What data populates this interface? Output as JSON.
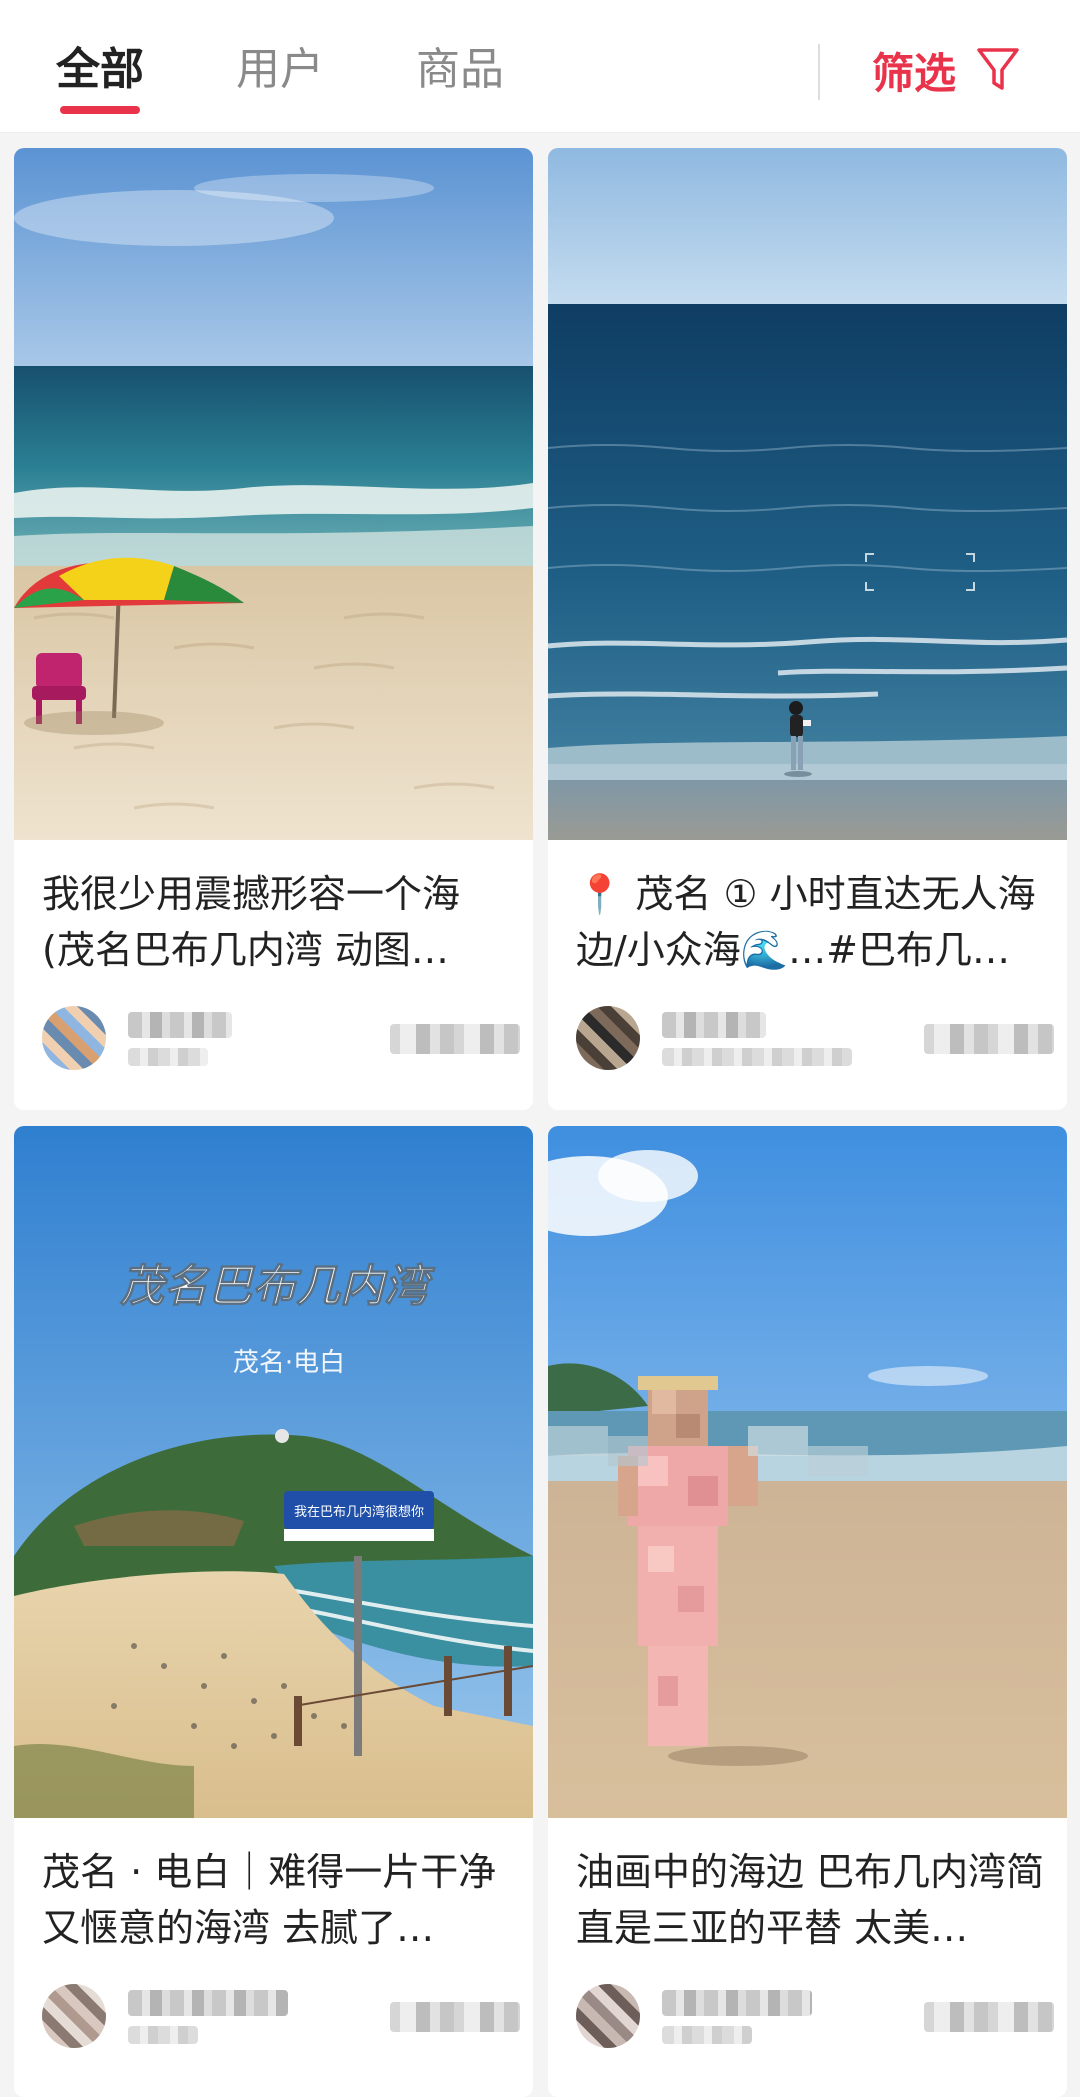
{
  "tabs": [
    {
      "label": "全部",
      "active": true
    },
    {
      "label": "用户",
      "active": false
    },
    {
      "label": "商品",
      "active": false
    }
  ],
  "filter": {
    "label": "筛选",
    "icon": "funnel-icon"
  },
  "colors": {
    "accent": "#e8334b"
  },
  "cards": [
    {
      "title": "我很少用震撼形容一个海(茂名巴布几内湾 动图…"
    },
    {
      "title_pin_icon": "📍",
      "title": "茂名 ① 小时直达无人海边/小众海🌊…#巴布几…"
    },
    {
      "title": "茂名 · 电白｜难得一片干净又惬意的海湾 去腻了…",
      "cover_text": {
        "headline": "茂名巴布几内湾",
        "subline": "茂名·电白",
        "sign": "我在巴布几内湾很想你"
      }
    },
    {
      "title": "油画中的海边 巴布几内湾简直是三亚的平替 太美…"
    }
  ]
}
